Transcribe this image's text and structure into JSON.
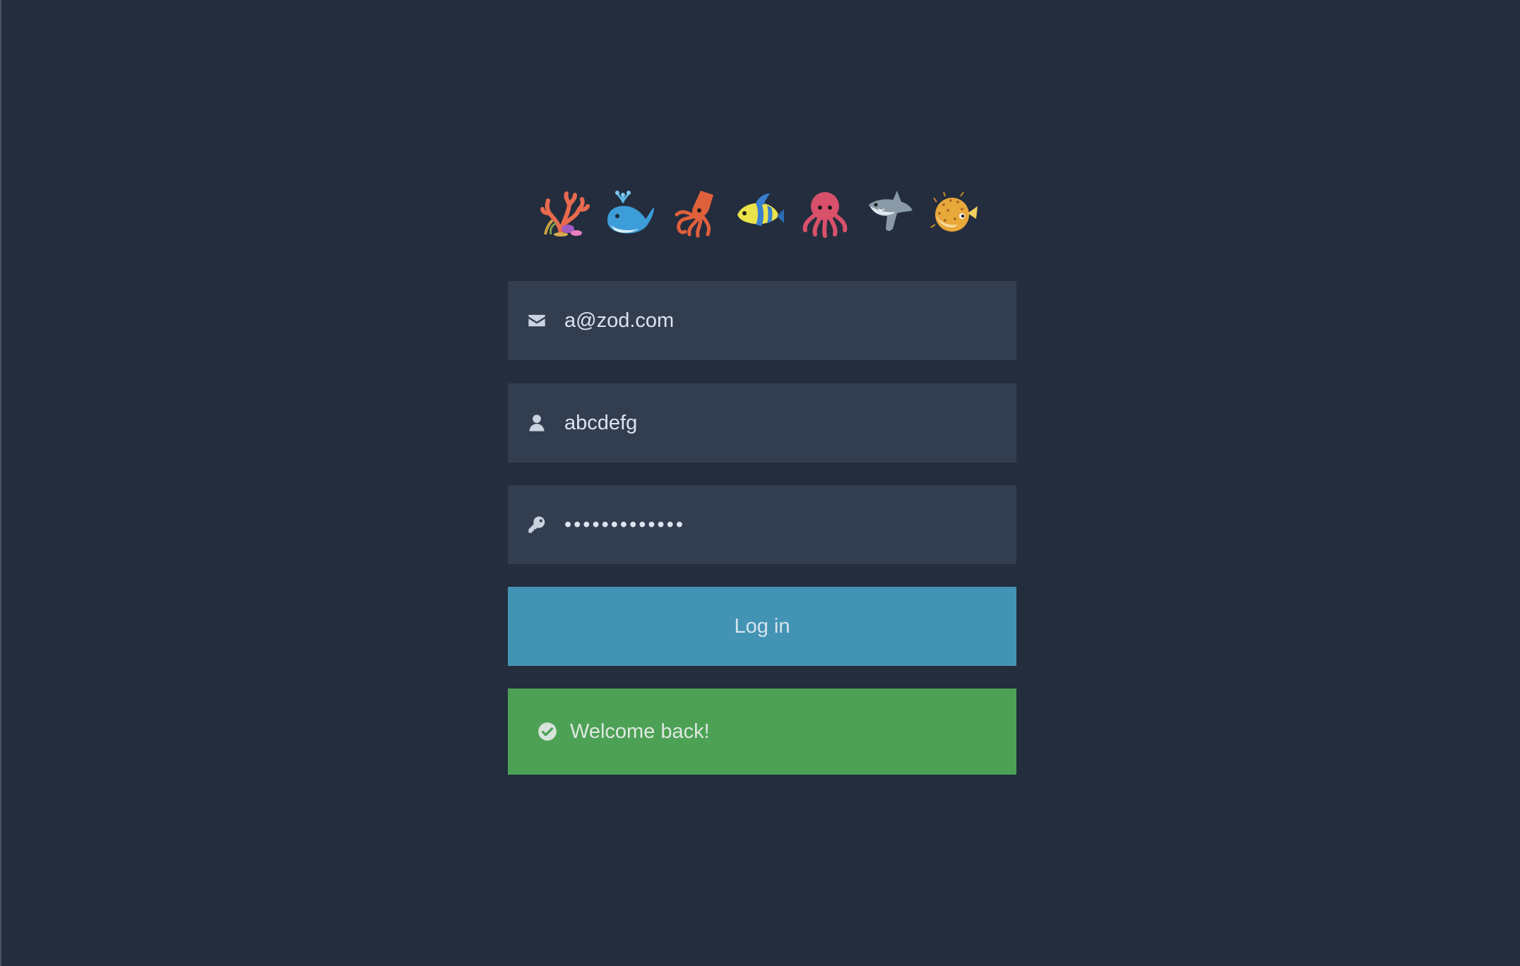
{
  "header": {
    "emojis": [
      "coral-icon",
      "whale-icon",
      "squid-icon",
      "tropical-fish-icon",
      "octopus-icon",
      "shark-icon",
      "blowfish-icon"
    ]
  },
  "form": {
    "email": {
      "value": "a@zod.com",
      "icon": "envelope-icon"
    },
    "username": {
      "value": "abcdefg",
      "icon": "user-icon"
    },
    "password": {
      "value": "•••••••••••••",
      "icon": "key-icon"
    },
    "submit_label": "Log in"
  },
  "alert": {
    "message": "Welcome back!",
    "icon": "check-circle-icon",
    "color": "#4ca155"
  },
  "colors": {
    "background": "#232d3d",
    "field": "#323e50",
    "button": "#4393b4",
    "success": "#4ca155"
  }
}
